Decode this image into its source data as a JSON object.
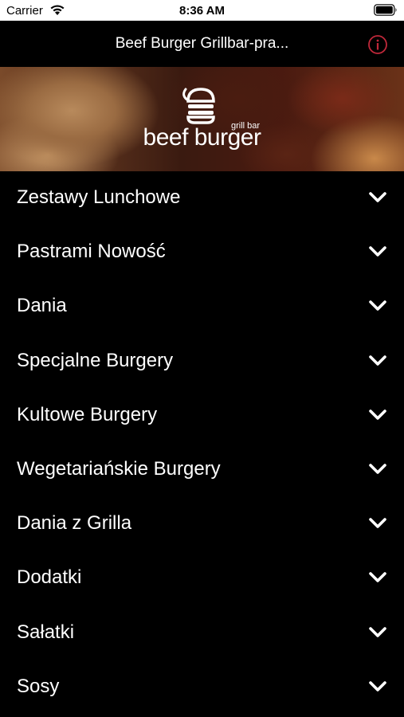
{
  "status_bar": {
    "carrier": "Carrier",
    "time": "8:36 AM"
  },
  "nav": {
    "title": "Beef Burger Grillbar-pra...",
    "info_icon": "info-icon",
    "info_color": "#c0283a"
  },
  "banner": {
    "logo_small": "grill bar",
    "logo_text": "beef burger"
  },
  "menu": {
    "items": [
      {
        "label": "Zestawy Lunchowe"
      },
      {
        "label": "Pastrami Nowość"
      },
      {
        "label": "Dania"
      },
      {
        "label": "Specjalne Burgery"
      },
      {
        "label": "Kultowe Burgery"
      },
      {
        "label": "Wegetariańskie Burgery"
      },
      {
        "label": "Dania z Grilla"
      },
      {
        "label": "Dodatki"
      },
      {
        "label": "Sałatki"
      },
      {
        "label": "Sosy"
      }
    ]
  }
}
